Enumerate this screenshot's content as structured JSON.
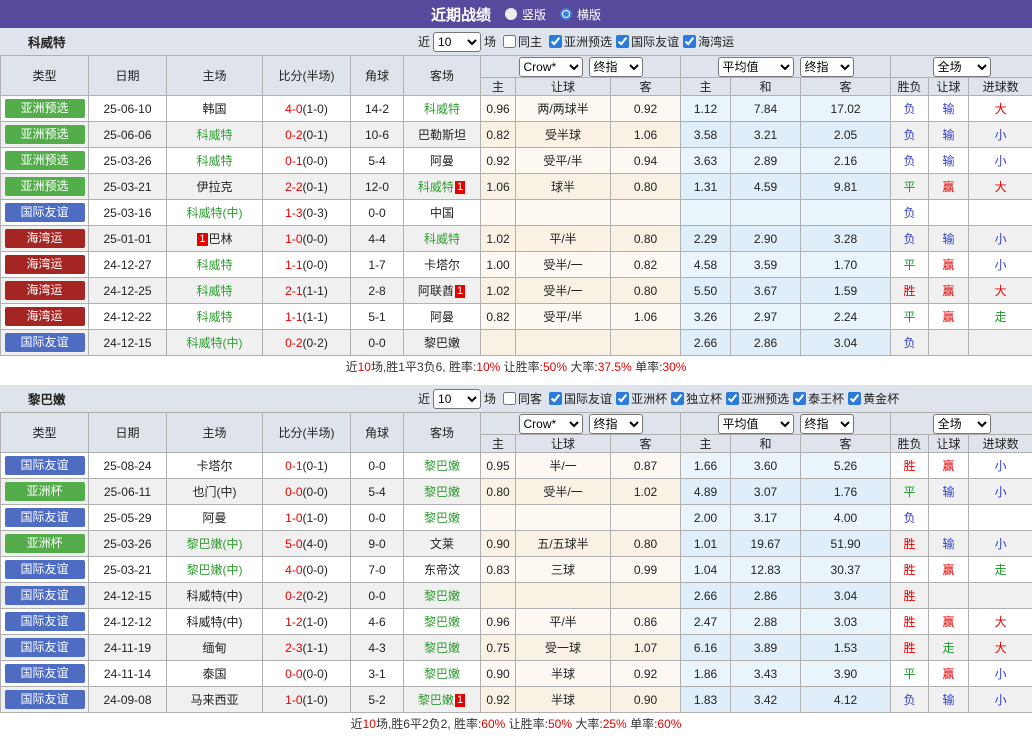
{
  "title_bar": {
    "title": "近期战绩",
    "radio_vertical": "竖版",
    "radio_horizontal": "横版"
  },
  "columns": {
    "type": "类型",
    "date": "日期",
    "home": "主场",
    "score_half": "比分(半场)",
    "corner": "角球",
    "away": "客场",
    "odds_home": "主",
    "odds_handicap": "让球",
    "odds_away": "客",
    "avg_home": "主",
    "avg_draw": "和",
    "avg_away": "客",
    "wdl": "胜负",
    "handicap_res": "让球",
    "goals": "进球数",
    "crow_select": "Crow*",
    "final_select": "终指",
    "avg_select": "平均值",
    "fulltime_select": "全场"
  },
  "colors": {
    "r": "#e60000",
    "g": "#169a25",
    "b": "#3340cc",
    "type": {
      "亚洲预选": "#53ad4a",
      "亚洲杯": "#53ad4a",
      "国际友谊": "#4e6cc2",
      "海湾运": "#a42522"
    }
  },
  "sections": [
    {
      "team": "科威特",
      "filter": {
        "prefix": "近",
        "count": "10",
        "suffix": "场",
        "same": "同主",
        "leagues": [
          "亚洲预选",
          "国际友谊",
          "海湾运"
        ]
      },
      "rows": [
        {
          "type": "亚洲预选",
          "date": "25-06-10",
          "home": {
            "n": "韩国"
          },
          "score": "4-0",
          "half": "(1-0)",
          "corner": "14-2",
          "away": {
            "n": "科威特",
            "g": 1
          },
          "crow": [
            "0.96",
            "两/两球半",
            "0.92"
          ],
          "avg": [
            "1.12",
            "7.84",
            "17.02"
          ],
          "res": [
            [
              "负",
              "b"
            ],
            [
              "输",
              "b"
            ],
            [
              "大",
              "r"
            ]
          ]
        },
        {
          "type": "亚洲预选",
          "date": "25-06-06",
          "home": {
            "n": "科威特",
            "g": 1
          },
          "score": "0-2",
          "half": "(0-1)",
          "corner": "10-6",
          "away": {
            "n": "巴勒斯坦"
          },
          "crow": [
            "0.82",
            "受半球",
            "1.06"
          ],
          "avg": [
            "3.58",
            "3.21",
            "2.05"
          ],
          "res": [
            [
              "负",
              "b"
            ],
            [
              "输",
              "b"
            ],
            [
              "小",
              "b"
            ]
          ]
        },
        {
          "type": "亚洲预选",
          "date": "25-03-26",
          "home": {
            "n": "科威特",
            "g": 1
          },
          "score": "0-1",
          "half": "(0-0)",
          "corner": "5-4",
          "away": {
            "n": "阿曼"
          },
          "crow": [
            "0.92",
            "受平/半",
            "0.94"
          ],
          "avg": [
            "3.63",
            "2.89",
            "2.16"
          ],
          "res": [
            [
              "负",
              "b"
            ],
            [
              "输",
              "b"
            ],
            [
              "小",
              "b"
            ]
          ]
        },
        {
          "type": "亚洲预选",
          "date": "25-03-21",
          "home": {
            "n": "伊拉克"
          },
          "score": "2-2",
          "half": "(0-1)",
          "corner": "12-0",
          "away": {
            "n": "科威特",
            "g": 1,
            "ra": "1"
          },
          "crow": [
            "1.06",
            "球半",
            "0.80"
          ],
          "avg": [
            "1.31",
            "4.59",
            "9.81"
          ],
          "res": [
            [
              "平",
              "g"
            ],
            [
              "赢",
              "r"
            ],
            [
              "大",
              "r"
            ]
          ]
        },
        {
          "type": "国际友谊",
          "date": "25-03-16",
          "home": {
            "n": "科威特(中)",
            "g": 1
          },
          "score": "1-3",
          "half": "(0-3)",
          "corner": "0-0",
          "away": {
            "n": "中国"
          },
          "crow": [
            "",
            "",
            ""
          ],
          "avg": [
            "",
            "",
            ""
          ],
          "res": [
            [
              "负",
              "b"
            ],
            [
              "",
              ""
            ],
            [
              "",
              ""
            ]
          ]
        },
        {
          "type": "海湾运",
          "date": "25-01-01",
          "home": {
            "n": "巴林",
            "rb": "1"
          },
          "score": "1-0",
          "half": "(0-0)",
          "corner": "4-4",
          "away": {
            "n": "科威特",
            "g": 1
          },
          "crow": [
            "1.02",
            "平/半",
            "0.80"
          ],
          "avg": [
            "2.29",
            "2.90",
            "3.28"
          ],
          "res": [
            [
              "负",
              "b"
            ],
            [
              "输",
              "b"
            ],
            [
              "小",
              "b"
            ]
          ]
        },
        {
          "type": "海湾运",
          "date": "24-12-27",
          "home": {
            "n": "科威特",
            "g": 1
          },
          "score": "1-1",
          "half": "(0-0)",
          "corner": "1-7",
          "away": {
            "n": "卡塔尔"
          },
          "crow": [
            "1.00",
            "受半/一",
            "0.82"
          ],
          "avg": [
            "4.58",
            "3.59",
            "1.70"
          ],
          "res": [
            [
              "平",
              "g"
            ],
            [
              "赢",
              "r"
            ],
            [
              "小",
              "b"
            ]
          ]
        },
        {
          "type": "海湾运",
          "date": "24-12-25",
          "home": {
            "n": "科威特",
            "g": 1
          },
          "score": "2-1",
          "half": "(1-1)",
          "corner": "2-8",
          "away": {
            "n": "阿联酋",
            "ra": "1"
          },
          "crow": [
            "1.02",
            "受半/一",
            "0.80"
          ],
          "avg": [
            "5.50",
            "3.67",
            "1.59"
          ],
          "res": [
            [
              "胜",
              "r"
            ],
            [
              "赢",
              "r"
            ],
            [
              "大",
              "r"
            ]
          ]
        },
        {
          "type": "海湾运",
          "date": "24-12-22",
          "home": {
            "n": "科威特",
            "g": 1
          },
          "score": "1-1",
          "half": "(1-1)",
          "corner": "5-1",
          "away": {
            "n": "阿曼"
          },
          "crow": [
            "0.82",
            "受平/半",
            "1.06"
          ],
          "avg": [
            "3.26",
            "2.97",
            "2.24"
          ],
          "res": [
            [
              "平",
              "g"
            ],
            [
              "赢",
              "r"
            ],
            [
              "走",
              "g"
            ]
          ]
        },
        {
          "type": "国际友谊",
          "date": "24-12-15",
          "home": {
            "n": "科威特(中)",
            "g": 1
          },
          "score": "0-2",
          "half": "(0-2)",
          "corner": "0-0",
          "away": {
            "n": "黎巴嫩"
          },
          "crow": [
            "",
            "",
            ""
          ],
          "avg": [
            "2.66",
            "2.86",
            "3.04"
          ],
          "res": [
            [
              "负",
              "b"
            ],
            [
              "",
              ""
            ],
            [
              "",
              ""
            ]
          ]
        }
      ],
      "summary": [
        [
          "近",
          0
        ],
        [
          "10",
          1
        ],
        [
          "场,胜1平3负6, 胜率:",
          0
        ],
        [
          "10%",
          1
        ],
        [
          " 让胜率:",
          0
        ],
        [
          "50%",
          1
        ],
        [
          " 大率:",
          0
        ],
        [
          "37.5%",
          1
        ],
        [
          " 单率:",
          0
        ],
        [
          "30%",
          1
        ]
      ]
    },
    {
      "team": "黎巴嫩",
      "filter": {
        "prefix": "近",
        "count": "10",
        "suffix": "场",
        "same": "同客",
        "leagues": [
          "国际友谊",
          "亚洲杯",
          "独立杯",
          "亚洲预选",
          "泰王杯",
          "黄金杯"
        ]
      },
      "rows": [
        {
          "type": "国际友谊",
          "date": "25-08-24",
          "home": {
            "n": "卡塔尔"
          },
          "score": "0-1",
          "half": "(0-1)",
          "corner": "0-0",
          "away": {
            "n": "黎巴嫩",
            "g": 1
          },
          "crow": [
            "0.95",
            "半/一",
            "0.87"
          ],
          "avg": [
            "1.66",
            "3.60",
            "5.26"
          ],
          "res": [
            [
              "胜",
              "r"
            ],
            [
              "赢",
              "r"
            ],
            [
              "小",
              "b"
            ]
          ]
        },
        {
          "type": "亚洲杯",
          "date": "25-06-11",
          "home": {
            "n": "也门(中)"
          },
          "score": "0-0",
          "half": "(0-0)",
          "corner": "5-4",
          "away": {
            "n": "黎巴嫩",
            "g": 1
          },
          "crow": [
            "0.80",
            "受半/一",
            "1.02"
          ],
          "avg": [
            "4.89",
            "3.07",
            "1.76"
          ],
          "res": [
            [
              "平",
              "g"
            ],
            [
              "输",
              "b"
            ],
            [
              "小",
              "b"
            ]
          ]
        },
        {
          "type": "国际友谊",
          "date": "25-05-29",
          "home": {
            "n": "阿曼"
          },
          "score": "1-0",
          "half": "(1-0)",
          "corner": "0-0",
          "away": {
            "n": "黎巴嫩",
            "g": 1
          },
          "crow": [
            "",
            "",
            ""
          ],
          "avg": [
            "2.00",
            "3.17",
            "4.00"
          ],
          "res": [
            [
              "负",
              "b"
            ],
            [
              "",
              ""
            ],
            [
              "",
              ""
            ]
          ]
        },
        {
          "type": "亚洲杯",
          "date": "25-03-26",
          "home": {
            "n": "黎巴嫩(中)",
            "g": 1
          },
          "score": "5-0",
          "half": "(4-0)",
          "corner": "9-0",
          "away": {
            "n": "文莱"
          },
          "crow": [
            "0.90",
            "五/五球半",
            "0.80"
          ],
          "avg": [
            "1.01",
            "19.67",
            "51.90"
          ],
          "res": [
            [
              "胜",
              "r"
            ],
            [
              "输",
              "b"
            ],
            [
              "小",
              "b"
            ]
          ]
        },
        {
          "type": "国际友谊",
          "date": "25-03-21",
          "home": {
            "n": "黎巴嫩(中)",
            "g": 1
          },
          "score": "4-0",
          "half": "(0-0)",
          "corner": "7-0",
          "away": {
            "n": "东帝汶"
          },
          "crow": [
            "0.83",
            "三球",
            "0.99"
          ],
          "avg": [
            "1.04",
            "12.83",
            "30.37"
          ],
          "res": [
            [
              "胜",
              "r"
            ],
            [
              "赢",
              "r"
            ],
            [
              "走",
              "g"
            ]
          ]
        },
        {
          "type": "国际友谊",
          "date": "24-12-15",
          "home": {
            "n": "科威特(中)"
          },
          "score": "0-2",
          "half": "(0-2)",
          "corner": "0-0",
          "away": {
            "n": "黎巴嫩",
            "g": 1
          },
          "crow": [
            "",
            "",
            ""
          ],
          "avg": [
            "2.66",
            "2.86",
            "3.04"
          ],
          "res": [
            [
              "胜",
              "r"
            ],
            [
              "",
              ""
            ],
            [
              "",
              ""
            ]
          ]
        },
        {
          "type": "国际友谊",
          "date": "24-12-12",
          "home": {
            "n": "科威特(中)"
          },
          "score": "1-2",
          "half": "(1-0)",
          "corner": "4-6",
          "away": {
            "n": "黎巴嫩",
            "g": 1
          },
          "crow": [
            "0.96",
            "平/半",
            "0.86"
          ],
          "avg": [
            "2.47",
            "2.88",
            "3.03"
          ],
          "res": [
            [
              "胜",
              "r"
            ],
            [
              "赢",
              "r"
            ],
            [
              "大",
              "r"
            ]
          ]
        },
        {
          "type": "国际友谊",
          "date": "24-11-19",
          "home": {
            "n": "缅甸"
          },
          "score": "2-3",
          "half": "(1-1)",
          "corner": "4-3",
          "away": {
            "n": "黎巴嫩",
            "g": 1
          },
          "crow": [
            "0.75",
            "受一球",
            "1.07"
          ],
          "avg": [
            "6.16",
            "3.89",
            "1.53"
          ],
          "res": [
            [
              "胜",
              "r"
            ],
            [
              "走",
              "g"
            ],
            [
              "大",
              "r"
            ]
          ]
        },
        {
          "type": "国际友谊",
          "date": "24-11-14",
          "home": {
            "n": "泰国"
          },
          "score": "0-0",
          "half": "(0-0)",
          "corner": "3-1",
          "away": {
            "n": "黎巴嫩",
            "g": 1
          },
          "crow": [
            "0.90",
            "半球",
            "0.92"
          ],
          "avg": [
            "1.86",
            "3.43",
            "3.90"
          ],
          "res": [
            [
              "平",
              "g"
            ],
            [
              "赢",
              "r"
            ],
            [
              "小",
              "b"
            ]
          ]
        },
        {
          "type": "国际友谊",
          "date": "24-09-08",
          "home": {
            "n": "马来西亚"
          },
          "score": "1-0",
          "half": "(1-0)",
          "corner": "5-2",
          "away": {
            "n": "黎巴嫩",
            "g": 1,
            "ra": "1"
          },
          "crow": [
            "0.92",
            "半球",
            "0.90"
          ],
          "avg": [
            "1.83",
            "3.42",
            "4.12"
          ],
          "res": [
            [
              "负",
              "b"
            ],
            [
              "输",
              "b"
            ],
            [
              "小",
              "b"
            ]
          ]
        }
      ],
      "summary": [
        [
          "近",
          0
        ],
        [
          "10",
          1
        ],
        [
          "场,胜6平2负2, 胜率:",
          0
        ],
        [
          "60%",
          1
        ],
        [
          " 让胜率:",
          0
        ],
        [
          "50%",
          1
        ],
        [
          " 大率:",
          0
        ],
        [
          "25%",
          1
        ],
        [
          " 单率:",
          0
        ],
        [
          "60%",
          1
        ]
      ]
    }
  ]
}
